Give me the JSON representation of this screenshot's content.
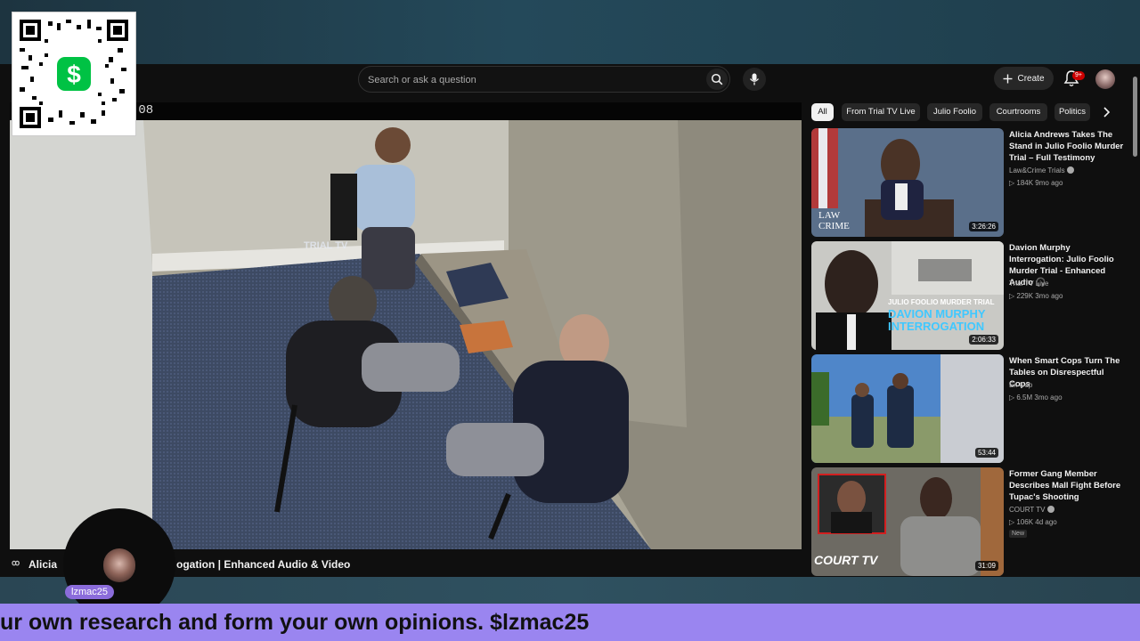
{
  "header": {
    "search_placeholder": "Search or ask a question",
    "create_label": "Create",
    "notifications_badge": "9+"
  },
  "player": {
    "timecode": ":08",
    "title_left": "Alicia",
    "title_right": "ogation | Enhanced Audio & Video",
    "watermark": "TRIAL TV"
  },
  "chips": [
    {
      "label": "All",
      "active": true
    },
    {
      "label": "From Trial TV Live"
    },
    {
      "label": "Julio Foolio"
    },
    {
      "label": "Courtrooms"
    },
    {
      "label": "Politics"
    }
  ],
  "recommendations": [
    {
      "title": "Alicia Andrews Takes The Stand in Julio Foolio Murder Trial – Full Testimony",
      "channel": "Law&Crime Trials",
      "meta": "▷ 184K  9mo ago",
      "duration": "3:26:26",
      "thumb_text": "LAW CRIME"
    },
    {
      "title": "Davion Murphy Interrogation: Julio Foolio Murder Trial - Enhanced Audio 🎧",
      "channel": "Trial TV Live",
      "meta": "▷ 229K  3mo ago",
      "duration": "2:06:33",
      "thumb_line1": "JULIO FOOLIO MURDER TRIAL",
      "thumb_line2": "DAVION MURPHY",
      "thumb_line3": "INTERROGATION"
    },
    {
      "title": "When Smart Cops Turn The Tables on Disrespectful Cops",
      "channel": "Ex Cop",
      "meta": "▷ 6.5M  3mo ago",
      "duration": "53:44"
    },
    {
      "title": "Former Gang Member Describes Mall Fight Before Tupac's Shooting",
      "channel": "COURT TV",
      "meta": "▷ 106K  4d ago",
      "badge": "New",
      "duration": "31:09",
      "thumb_text": "COURT TV"
    }
  ],
  "overlay": {
    "handle": "lzmac25",
    "ticker": "ur own research and form your own opinions. $lzmac25"
  }
}
